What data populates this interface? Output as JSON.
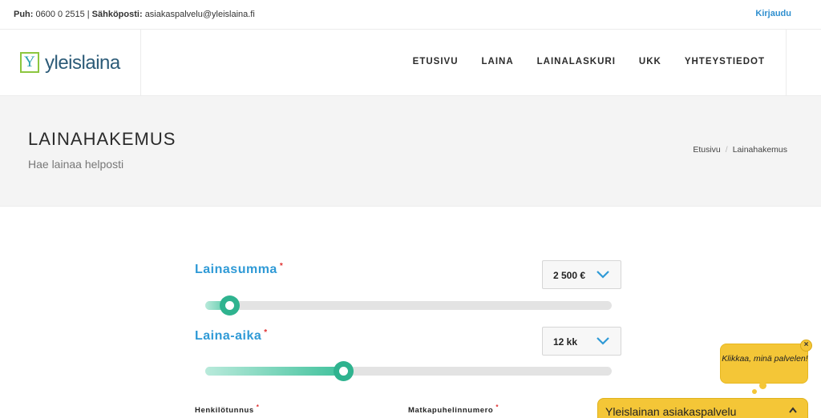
{
  "topbar": {
    "phone_label": "Puh:",
    "phone": "0600 0 2515",
    "separator": "|",
    "email_label": "Sähköposti:",
    "email": "asiakaspalvelu@yleislaina.fi",
    "login": "Kirjaudu"
  },
  "logo": {
    "mark": "Y",
    "text": "yleislaina"
  },
  "nav": [
    "ETUSIVU",
    "LAINA",
    "LAINALASKURI",
    "UKK",
    "YHTEYSTIEDOT"
  ],
  "page": {
    "title": "LAINAHAKEMUS",
    "subtitle": "Hae lainaa helposti",
    "breadcrumb": [
      "Etusivu",
      "Lainahakemus"
    ],
    "breadcrumb_sep": "/"
  },
  "form": {
    "amount": {
      "label": "Lainasumma",
      "required": "*",
      "value": "2 500 €",
      "slider_fraction": 0.06
    },
    "term": {
      "label": "Laina-aika",
      "required": "*",
      "value": "12 kk",
      "slider_fraction": 0.34
    },
    "ssn_label": "Henkilötunnus",
    "phone_label": "Matkapuhelinnumero",
    "required_mark": "*"
  },
  "chat": {
    "bubble_text": "Klikkaa, minä palvelen!",
    "bubble_close": "×",
    "bar_title": "Yleislainan asiakaspalvelu"
  },
  "colors": {
    "accent_blue": "#2f9ad6",
    "slider_green": "#2fb38f",
    "chat_yellow": "#f4c637",
    "required_red": "#e03030"
  },
  "icons": [
    "chevron-down-icon",
    "chevron-up-icon",
    "close-icon"
  ]
}
